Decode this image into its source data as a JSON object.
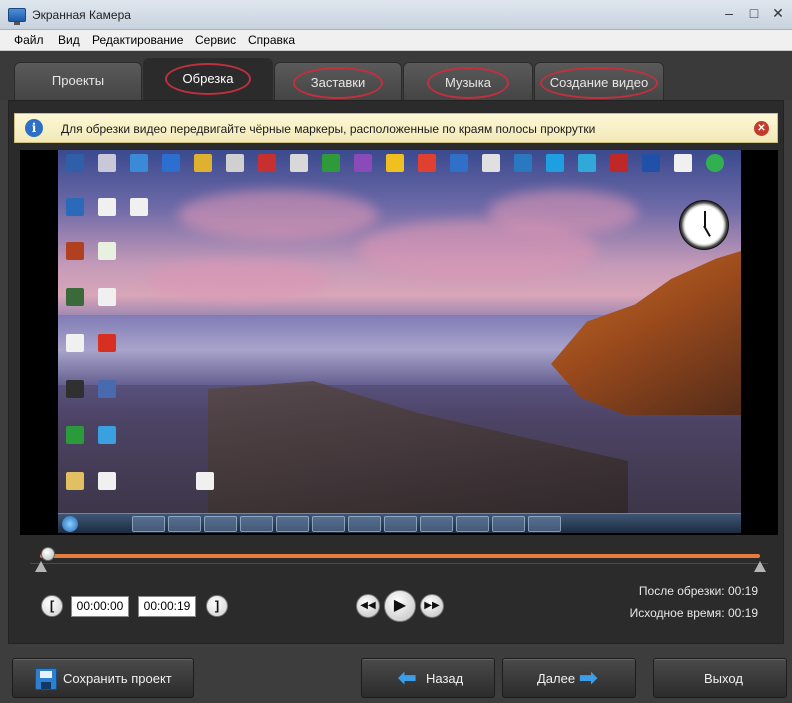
{
  "window": {
    "title": "Экранная Камера"
  },
  "menu": {
    "items": [
      "Файл",
      "Вид",
      "Редактирование",
      "Сервис",
      "Справка"
    ]
  },
  "tabs": [
    {
      "label": "Проекты"
    },
    {
      "label": "Обрезка"
    },
    {
      "label": "Заставки"
    },
    {
      "label": "Музыка"
    },
    {
      "label": "Создание видео"
    }
  ],
  "info": {
    "text": "Для обрезки видео передвигайте чёрные маркеры, расположенные по краям полосы прокрутки"
  },
  "trim": {
    "start_time": "00:00:00",
    "end_time": "00:00:19",
    "after_trim_label": "После обрезки:",
    "after_trim_value": "00:19",
    "original_label": "Исходное время:",
    "original_value": "00:19",
    "playback_position": 0.0
  },
  "buttons": {
    "save_project": "Сохранить проект",
    "back": "Назад",
    "next": "Далее",
    "exit": "Выход"
  },
  "colors": {
    "accent_track": "#e57b3c",
    "highlight_circle": "#c0303e",
    "info_bg": "#f8f0c6"
  }
}
